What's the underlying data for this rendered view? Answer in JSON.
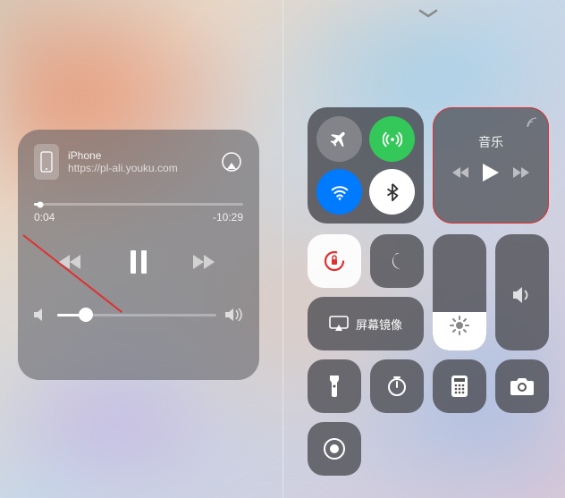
{
  "media": {
    "device_label": "iPhone",
    "source_url_display": "https://pl-ali.youku.com",
    "elapsed": "0:04",
    "remaining": "-10:29"
  },
  "cc": {
    "music_tile_label": "音乐",
    "mirror_label": "屏幕镜像"
  },
  "icons": {
    "airplay": "airplay-icon",
    "airplane": "airplane-icon",
    "cellular": "cellular-icon",
    "wifi": "wifi-icon",
    "bluetooth": "bluetooth-icon",
    "lock_rotation": "rotation-lock-icon",
    "dnd": "moon-icon",
    "mirror": "screen-mirror-icon",
    "brightness": "sun-icon",
    "volume": "speaker-icon",
    "flashlight": "flashlight-icon",
    "timer": "timer-icon",
    "calculator": "calculator-icon",
    "camera": "camera-icon",
    "record": "record-icon"
  },
  "colors": {
    "green": "#34c759",
    "blue": "#007aff",
    "highlight": "#e03030"
  }
}
